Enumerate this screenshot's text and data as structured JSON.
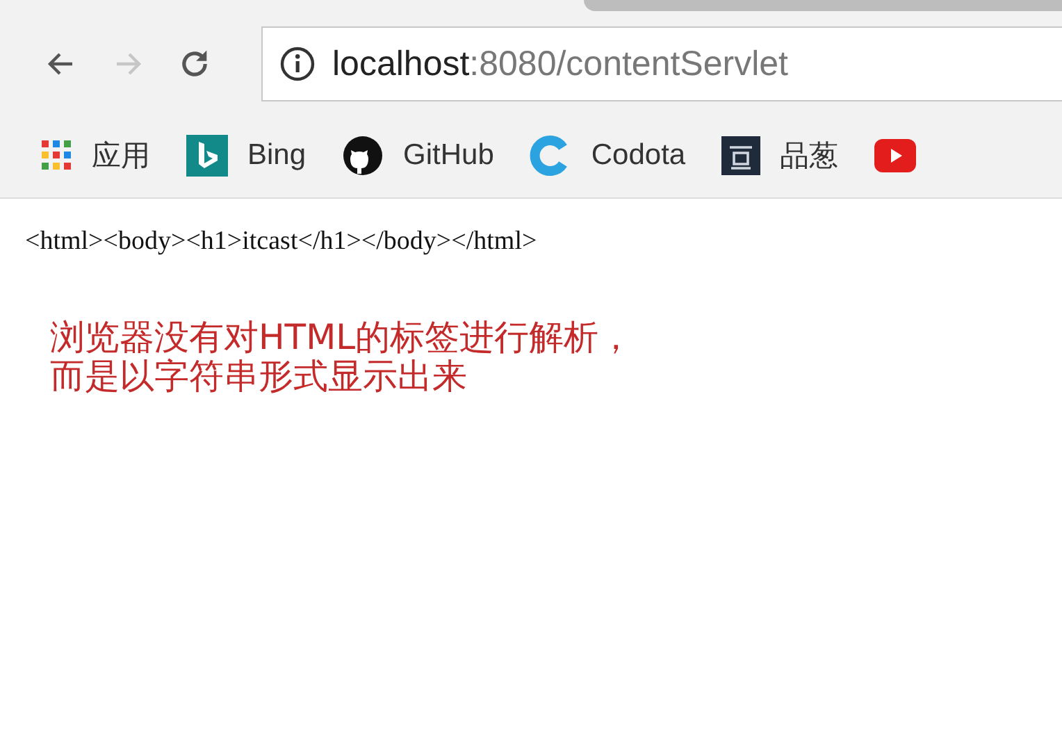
{
  "toolbar": {
    "back": {
      "disabled": false
    },
    "forward": {
      "disabled": true
    },
    "address": {
      "host": "localhost",
      "path": ":8080/contentServlet"
    }
  },
  "bookmarks": [
    {
      "kind": "apps",
      "label": "应用"
    },
    {
      "kind": "bing",
      "label": "Bing"
    },
    {
      "kind": "github",
      "label": "GitHub"
    },
    {
      "kind": "codota",
      "label": "Codota"
    },
    {
      "kind": "dark",
      "label": "品葱"
    },
    {
      "kind": "youtube"
    }
  ],
  "page": {
    "source": "<html><body><h1>itcast</h1></body></html>",
    "annotation": [
      "浏览器没有对HTML的标签进行解析，",
      "而是以字符串形式显示出来"
    ]
  }
}
